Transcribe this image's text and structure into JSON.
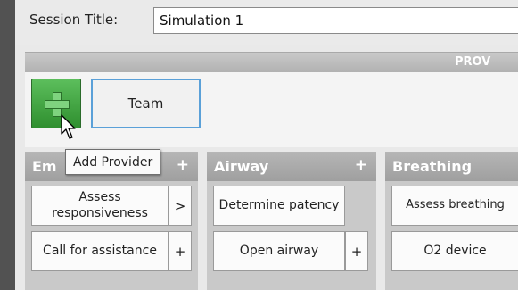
{
  "session": {
    "label": "Session Title:",
    "value": "Simulation 1"
  },
  "providers": {
    "header": "PROV",
    "add_button_tooltip": "Add Provider",
    "team_label": "Team"
  },
  "panels": [
    {
      "title": "Em",
      "plus": "+",
      "cards": [
        {
          "label": "Assess responsiveness",
          "action": ">"
        },
        {
          "label": "Call for assistance",
          "action": "+"
        }
      ]
    },
    {
      "title": "Airway",
      "plus": "+",
      "cards": [
        {
          "label": "Determine patency",
          "action": ""
        },
        {
          "label": "Open airway",
          "action": "+"
        }
      ]
    },
    {
      "title": "Breathing",
      "plus": "",
      "cards": [
        {
          "label": "Assess breathing",
          "action": ""
        },
        {
          "label": "O2 device",
          "action": ""
        }
      ]
    }
  ],
  "icons": {
    "add": "plus-icon",
    "cursor": "cursor-icon"
  },
  "colors": {
    "accent_green": "#3ea03e",
    "focus_blue": "#5aa0d8",
    "panel_gray": "#a8a8a8"
  }
}
